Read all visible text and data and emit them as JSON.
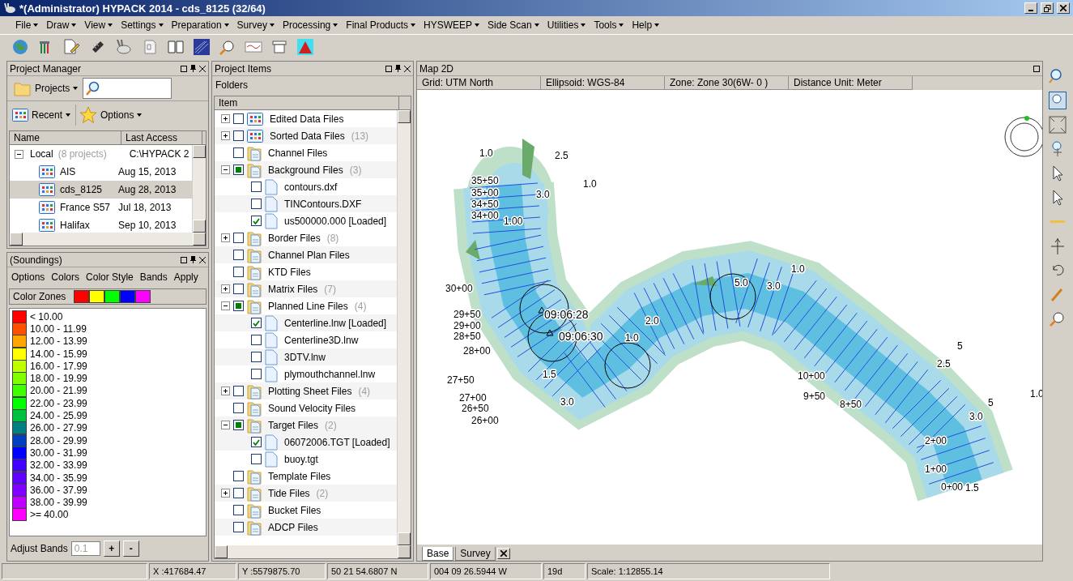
{
  "window": {
    "title": "*(Administrator) HYPACK 2014 - cds_8125 (32/64)"
  },
  "menu": [
    "File",
    "Draw",
    "View",
    "Settings",
    "Preparation",
    "Survey",
    "Processing",
    "Final Products",
    "HYSWEEP",
    "Side Scan",
    "Utilities",
    "Tools",
    "Help"
  ],
  "project_manager": {
    "title": "Project Manager",
    "projects_button": "Projects",
    "recent_button": "Recent",
    "options_button": "Options",
    "columns": [
      "Name",
      "Last Access"
    ],
    "group": {
      "name": "Local",
      "count": "(8 projects)",
      "path": "C:\\HYPACK 2",
      "expanded": true
    },
    "rows": [
      {
        "name": "AIS",
        "date": "Aug 15, 2013",
        "selected": false
      },
      {
        "name": "cds_8125",
        "date": "Aug 28, 2013",
        "selected": true
      },
      {
        "name": "France S57",
        "date": "Jul 18, 2013",
        "selected": false
      },
      {
        "name": "Halifax",
        "date": "Sep 10, 2013",
        "selected": false
      }
    ]
  },
  "soundings": {
    "title": "(Soundings)",
    "menu": [
      "Options",
      "Colors",
      "Color Style",
      "Bands",
      "Apply"
    ],
    "zones_label": "Color Zones",
    "zone_swatches": [
      {
        "color": "#ff0000"
      },
      {
        "color": "#ffff00"
      },
      {
        "color": "#00ff00"
      },
      {
        "color": "#0000ff"
      },
      {
        "color": "#ff00ff"
      }
    ],
    "bands": [
      {
        "label": "< 10.00",
        "color": "#ff0000"
      },
      {
        "label": "10.00 - 11.99",
        "color": "#ff5000"
      },
      {
        "label": "12.00 - 13.99",
        "color": "#ffa500"
      },
      {
        "label": "14.00 - 15.99",
        "color": "#ffff00"
      },
      {
        "label": "16.00 - 17.99",
        "color": "#c0ff00"
      },
      {
        "label": "18.00 - 19.99",
        "color": "#80ff00"
      },
      {
        "label": "20.00 - 21.99",
        "color": "#40ff00"
      },
      {
        "label": "22.00 - 23.99",
        "color": "#00ff00"
      },
      {
        "label": "24.00 - 25.99",
        "color": "#00c040"
      },
      {
        "label": "26.00 - 27.99",
        "color": "#008080"
      },
      {
        "label": "28.00 - 29.99",
        "color": "#0040c0"
      },
      {
        "label": "30.00 - 31.99",
        "color": "#0000ff"
      },
      {
        "label": "32.00 - 33.99",
        "color": "#4000ff"
      },
      {
        "label": "34.00 - 35.99",
        "color": "#6000ff"
      },
      {
        "label": "36.00 - 37.99",
        "color": "#8000ff"
      },
      {
        "label": "38.00 - 39.99",
        "color": "#c000ff"
      },
      {
        "label": ">= 40.00",
        "color": "#ff00ff"
      }
    ],
    "adjust_label": "Adjust Bands",
    "adjust_value": "0.1",
    "buttons": [
      "+",
      "-"
    ]
  },
  "project_items": {
    "title": "Project Items",
    "folders_label": "Folders",
    "column": "Item",
    "items": [
      {
        "label": "Edited Data Files",
        "kind": "data",
        "partial": false,
        "expanded": false
      },
      {
        "label": "Sorted Data Files",
        "count": "(13)",
        "kind": "data",
        "partial": false,
        "expanded": false
      },
      {
        "label": "Channel Files",
        "kind": "folder",
        "partial": false
      },
      {
        "label": "Background Files",
        "count": "(3)",
        "kind": "folder",
        "partial": true,
        "expanded": true,
        "children": [
          {
            "label": "contours.dxf",
            "kind": "file",
            "checked": false
          },
          {
            "label": "TINContours.DXF",
            "kind": "file",
            "checked": false
          },
          {
            "label": "us500000.000 [Loaded]",
            "kind": "file",
            "checked": true
          }
        ]
      },
      {
        "label": "Border Files",
        "count": "(8)",
        "kind": "folder",
        "partial": false,
        "expanded": false
      },
      {
        "label": "Channel Plan Files",
        "kind": "folder",
        "partial": false
      },
      {
        "label": "KTD Files",
        "kind": "folder",
        "partial": false
      },
      {
        "label": "Matrix Files",
        "count": "(7)",
        "kind": "folder",
        "partial": false,
        "expanded": false
      },
      {
        "label": "Planned Line Files",
        "count": "(4)",
        "kind": "folder",
        "partial": true,
        "expanded": true,
        "children": [
          {
            "label": "Centerline.lnw [Loaded]",
            "kind": "file",
            "checked": true
          },
          {
            "label": "Centerline3D.lnw",
            "kind": "file",
            "checked": false
          },
          {
            "label": "3DTV.lnw",
            "kind": "file",
            "checked": false
          },
          {
            "label": "plymouthchannel.lnw",
            "kind": "file",
            "checked": false
          }
        ]
      },
      {
        "label": "Plotting Sheet Files",
        "count": "(4)",
        "kind": "folder",
        "partial": false,
        "expanded": false
      },
      {
        "label": "Sound Velocity Files",
        "kind": "folder",
        "partial": false
      },
      {
        "label": "Target Files",
        "count": "(2)",
        "kind": "folder",
        "partial": true,
        "expanded": true,
        "children": [
          {
            "label": "06072006.TGT [Loaded]",
            "kind": "file",
            "checked": true
          },
          {
            "label": "buoy.tgt",
            "kind": "file",
            "checked": false
          }
        ]
      },
      {
        "label": "Template Files",
        "kind": "folder",
        "partial": false
      },
      {
        "label": "Tide Files",
        "count": "(2)",
        "kind": "folder",
        "partial": false,
        "expanded": false
      },
      {
        "label": "Bucket Files",
        "kind": "folder",
        "partial": false
      },
      {
        "label": "ADCP Files",
        "kind": "folder",
        "partial": false
      }
    ]
  },
  "map": {
    "title": "Map 2D",
    "info": [
      "Grid: UTM North",
      "Ellipsoid: WGS-84",
      "Zone: Zone 30(6W- 0 )",
      "Distance Unit: Meter"
    ],
    "labels": [
      {
        "text": "1.0",
        "kind": "depth"
      },
      {
        "text": "2.5",
        "kind": "depth"
      },
      {
        "text": "1.0",
        "kind": "depth"
      },
      {
        "text": "35+50",
        "kind": "station"
      },
      {
        "text": "35+00",
        "kind": "station"
      },
      {
        "text": "34+50",
        "kind": "station"
      },
      {
        "text": "34+00",
        "kind": "station"
      },
      {
        "text": "3.0",
        "kind": "depth"
      },
      {
        "text": "1.00",
        "kind": "depth"
      },
      {
        "text": "30+00",
        "kind": "station"
      },
      {
        "text": "29+50",
        "kind": "station"
      },
      {
        "text": "29+00",
        "kind": "station"
      },
      {
        "text": "28+50",
        "kind": "station"
      },
      {
        "text": "28+00",
        "kind": "station"
      },
      {
        "text": "09:06:28",
        "kind": "time"
      },
      {
        "text": "09:06:30",
        "kind": "time"
      },
      {
        "text": "27+50",
        "kind": "station"
      },
      {
        "text": "27+00",
        "kind": "station"
      },
      {
        "text": "26+50",
        "kind": "station"
      },
      {
        "text": "26+00",
        "kind": "station"
      },
      {
        "text": "5.0",
        "kind": "depth"
      },
      {
        "text": "1.0",
        "kind": "depth"
      },
      {
        "text": "3.0",
        "kind": "depth"
      },
      {
        "text": "5",
        "kind": "depth"
      },
      {
        "text": "2.5",
        "kind": "depth"
      },
      {
        "text": "1.0",
        "kind": "depth"
      },
      {
        "text": "5",
        "kind": "depth"
      },
      {
        "text": "0+00",
        "kind": "station"
      },
      {
        "text": "1.5",
        "kind": "depth"
      },
      {
        "text": "2+00",
        "kind": "station"
      },
      {
        "text": "1+00",
        "kind": "station"
      },
      {
        "text": "10+00",
        "kind": "station"
      },
      {
        "text": "9+50",
        "kind": "station"
      },
      {
        "text": "8+50",
        "kind": "station"
      },
      {
        "text": "3.0",
        "kind": "depth"
      },
      {
        "text": "2.0",
        "kind": "depth"
      },
      {
        "text": "1.0",
        "kind": "depth"
      },
      {
        "text": "1.5",
        "kind": "depth"
      },
      {
        "text": "3.0",
        "kind": "depth"
      }
    ],
    "tabs": [
      {
        "label": "Base",
        "selected": true
      },
      {
        "label": "Survey",
        "selected": false
      }
    ]
  },
  "status_bar": [
    "X :417684.47",
    "Y :5579875.70",
    "50 21 54.6807 N",
    "004 09 26.5944 W",
    "19d",
    "Scale: 1:12855.14"
  ]
}
